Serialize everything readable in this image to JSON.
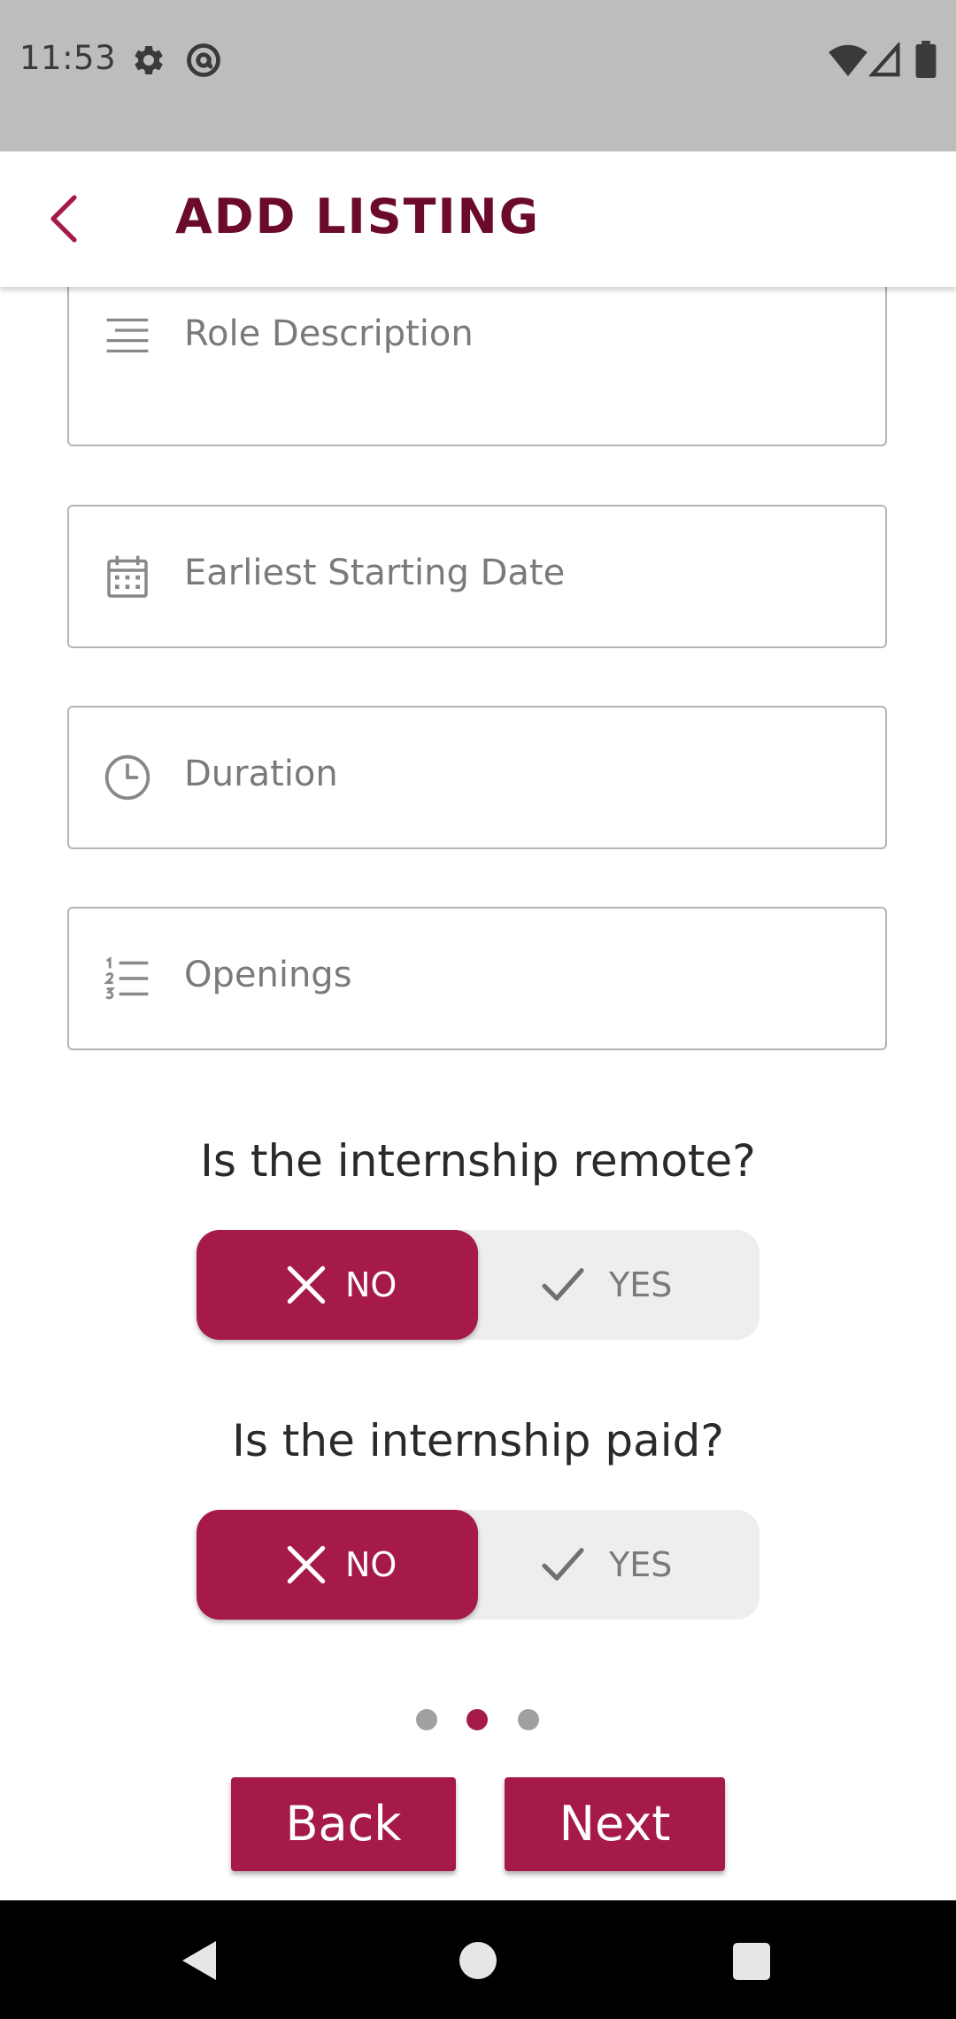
{
  "status_bar": {
    "time": "11:53",
    "left_icons": [
      "gear-icon",
      "at-sign-icon"
    ],
    "right_icons": [
      "wifi-icon",
      "signal-icon",
      "battery-icon"
    ]
  },
  "app_bar": {
    "back_icon": "chevron-left-icon",
    "title": "ADD LISTING"
  },
  "form": {
    "fields": [
      {
        "label": "Role Description",
        "icon": "notes-icon"
      },
      {
        "label": "Earliest Starting Date",
        "icon": "calendar-icon"
      },
      {
        "label": "Duration",
        "icon": "clock-icon"
      },
      {
        "label": "Openings",
        "icon": "numbered-list-icon"
      }
    ]
  },
  "questions": [
    {
      "text": "Is the internship remote?",
      "no_label": "NO",
      "yes_label": "YES",
      "selected": "NO"
    },
    {
      "text": "Is the internship paid?",
      "no_label": "NO",
      "yes_label": "YES",
      "selected": "NO"
    }
  ],
  "pager": {
    "total": 3,
    "active_index": 1
  },
  "buttons": {
    "back_label": "Back",
    "next_label": "Next"
  },
  "nav_bar": {
    "icons": [
      "nav-back-icon",
      "nav-home-icon",
      "nav-recents-icon"
    ]
  },
  "colors": {
    "accent": "#a51a46",
    "title": "#6b0a2a",
    "status_bar": "#bdbdbd",
    "toggle_bg": "#eeeeee"
  }
}
